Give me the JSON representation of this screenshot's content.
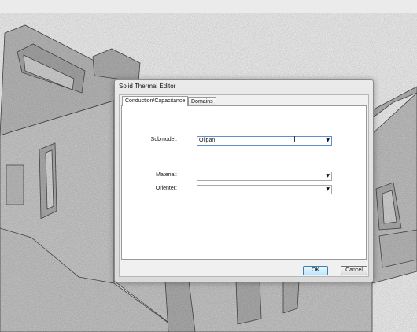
{
  "dialog": {
    "title": "Solid Thermal Editor",
    "tabs": [
      {
        "label": "Conduction/Capacitance",
        "active": true
      },
      {
        "label": "Domains",
        "active": false
      }
    ],
    "fields": {
      "submodel": {
        "label": "Submodel:",
        "value": "Oilpan"
      },
      "material": {
        "label": "Material:",
        "value": ""
      },
      "orienter": {
        "label": "Orienter:",
        "value": ""
      }
    },
    "buttons": {
      "ok": "OK",
      "cancel": "Cancel"
    }
  }
}
